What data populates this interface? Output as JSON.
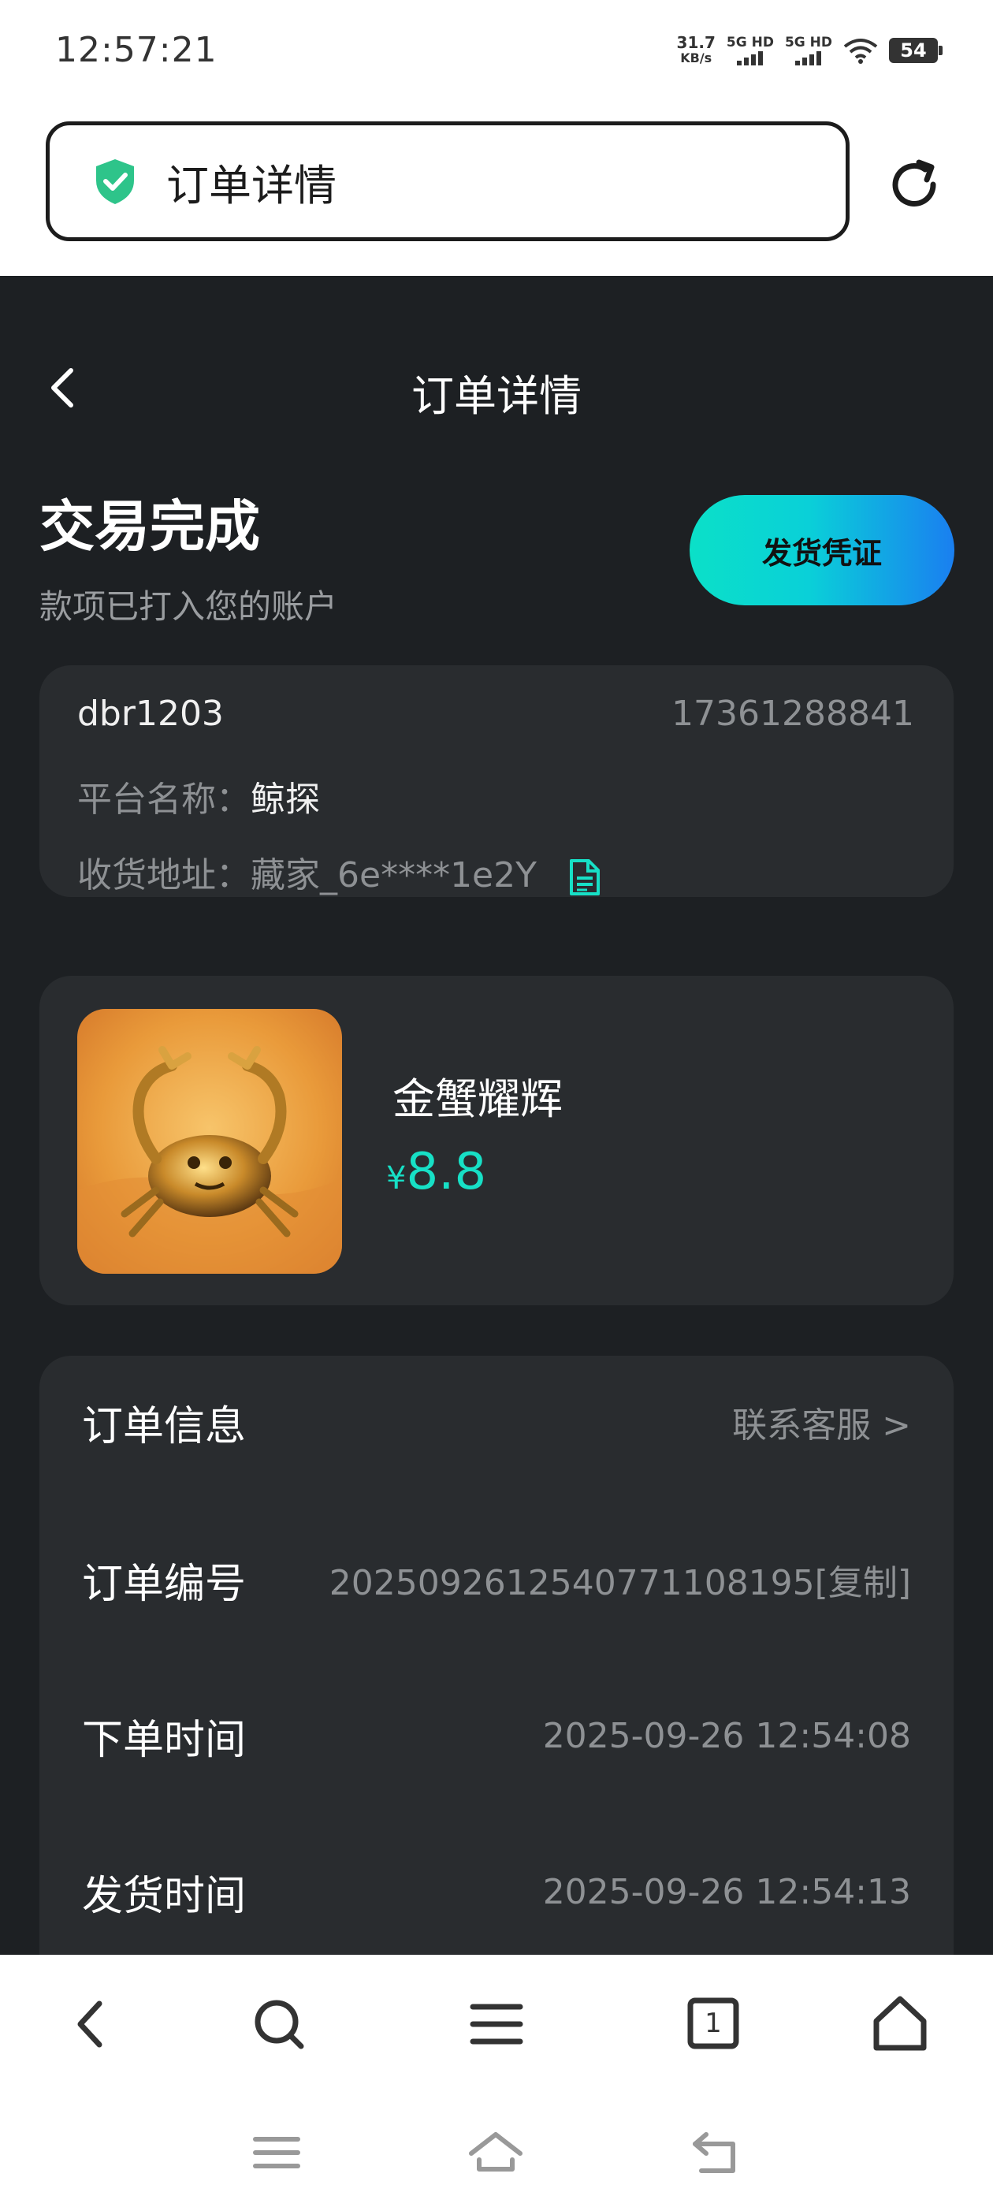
{
  "status_bar": {
    "time": "12:57:21",
    "net_speed_value": "31.7",
    "net_speed_unit": "KB/s",
    "sim1_label": "5G HD",
    "sim2_label": "5G HD",
    "battery": "54"
  },
  "browser": {
    "url_title": "订单详情",
    "secure_icon": "shield-check-icon",
    "reload_icon": "reload-icon"
  },
  "header": {
    "title": "订单详情",
    "back_icon": "chevron-left-icon"
  },
  "trade": {
    "status_title": "交易完成",
    "status_subtitle": "款项已打入您的账户",
    "proof_button": "发货凭证"
  },
  "user_card": {
    "username": "dbr1203",
    "phone": "17361288841",
    "platform_label": "平台名称：",
    "platform_value": "鲸探",
    "address_label": "收货地址：",
    "address_value": "藏家_6e****1e2Y",
    "copy_icon": "document-icon"
  },
  "goods": {
    "name": "金蟹耀辉",
    "currency": "¥",
    "price": "8.8"
  },
  "order": {
    "section_title": "订单信息",
    "contact_link": "联系客服 >",
    "rows": [
      {
        "label": "订单编号",
        "value": "2025092612540771108195[复制]"
      },
      {
        "label": "下单时间",
        "value": "2025-09-26 12:54:08"
      },
      {
        "label": "发货时间",
        "value": "2025-09-26 12:54:13"
      }
    ]
  },
  "browser_nav": {
    "back": "back-icon",
    "search": "search-icon",
    "menu": "menu-icon",
    "tabs_count": "1",
    "home": "home-icon"
  },
  "colors": {
    "accent": "#17e0c6",
    "page_bg": "#1d2023",
    "card_bg": "#292c2f",
    "gradient_start": "#0be0c8",
    "gradient_end": "#1a7ff0"
  }
}
